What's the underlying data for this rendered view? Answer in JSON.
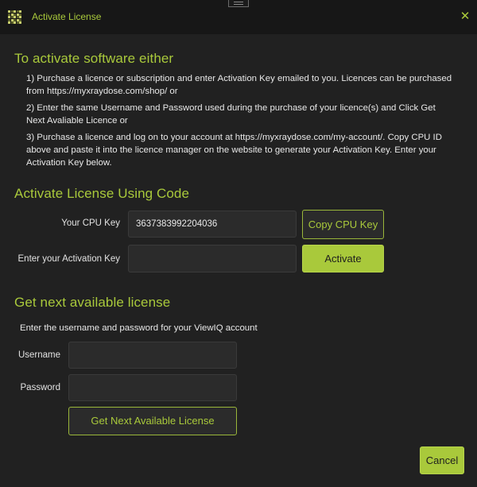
{
  "window": {
    "title": "Activate License",
    "accent": "#a9c93b"
  },
  "section1": {
    "heading": "To activate software either",
    "step1": "1) Purchase a licence or subscription and enter Activation Key emailed to you. Licences can be purchased from https://myxraydose.com/shop/ or",
    "step2": "2) Enter the same Username and Password used during the purchase of your licence(s) and Click Get Next Avaliable Licence or",
    "step3": "3) Purchase a licence and log on to your account at https://myxraydose.com/my-account/. Copy CPU ID above and paste it into the licence manager on the website to generate your Activation Key. Enter your Activation Key below."
  },
  "section2": {
    "heading": "Activate License Using Code",
    "cpu_label": "Your CPU Key",
    "cpu_value": "3637383992204036",
    "copy_button": "Copy CPU Key",
    "activation_label": "Enter your Activation Key",
    "activation_value": "",
    "activate_button": "Activate"
  },
  "section3": {
    "heading": "Get next available license",
    "instructions": "Enter the username and password for your ViewIQ account",
    "username_label": "Username",
    "username_value": "",
    "password_label": "Password",
    "password_value": "",
    "get_license_button": "Get Next Available License"
  },
  "footer": {
    "cancel_button": "Cancel"
  },
  "icons": {
    "app": "grid-logo-icon",
    "close": "close-icon",
    "drag": "drag-handle-icon"
  }
}
